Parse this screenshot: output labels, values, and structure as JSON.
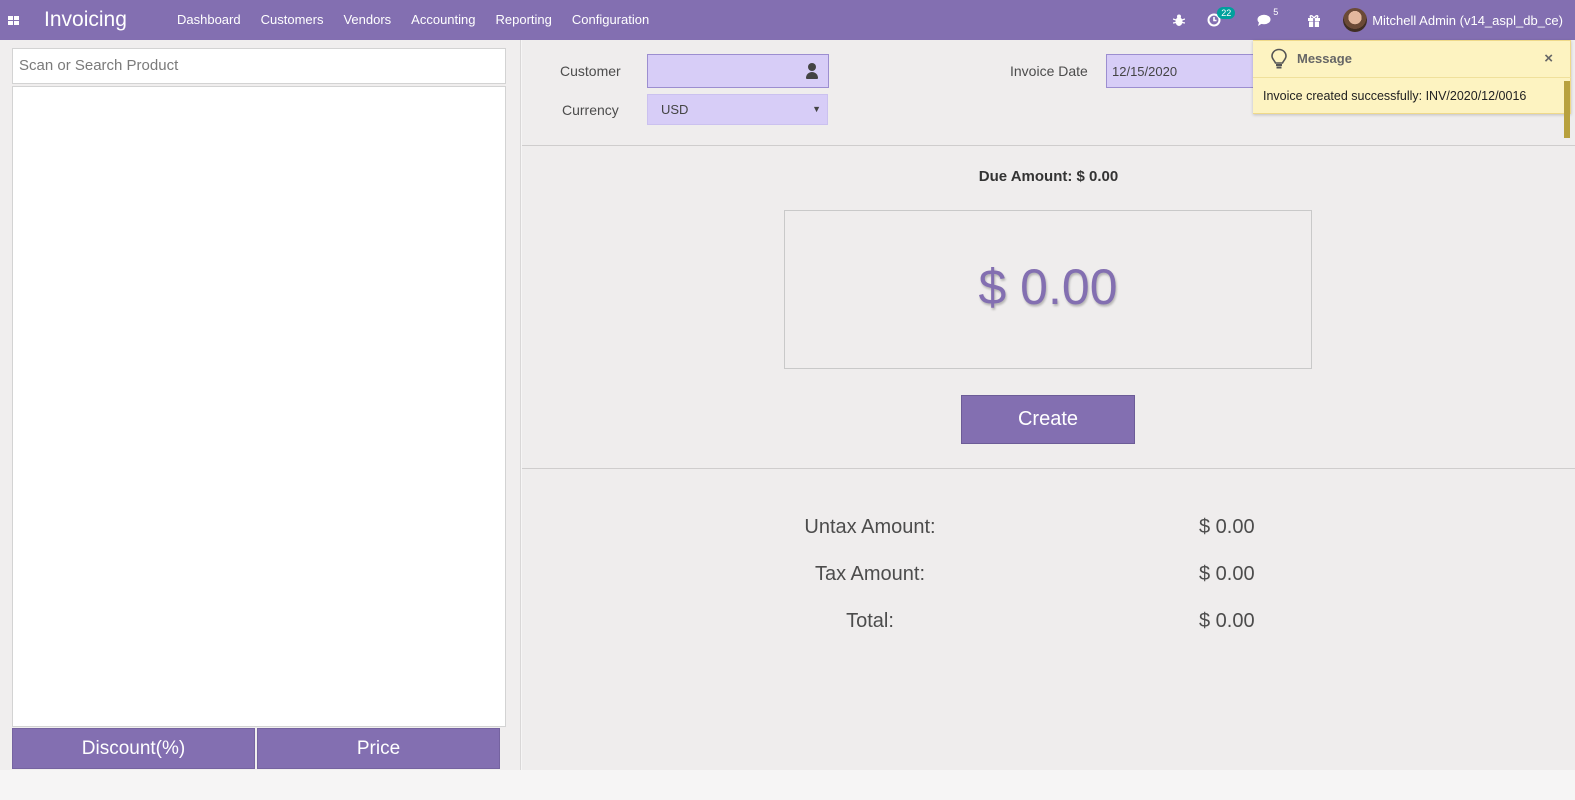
{
  "navbar": {
    "app_title": "Invoicing",
    "menu": [
      "Dashboard",
      "Customers",
      "Vendors",
      "Accounting",
      "Reporting",
      "Configuration"
    ],
    "activity_count": "22",
    "messages_count": "5",
    "user_name": "Mitchell Admin (v14_aspl_db_ce)",
    "icons": [
      "apps-grid-icon",
      "bug-icon",
      "activity-clock-icon",
      "chat-icon",
      "gift-icon"
    ],
    "color": "#836fb1"
  },
  "left_panel": {
    "search_placeholder": "Scan or Search Product",
    "discount_label": "Discount(%)",
    "price_label": "Price"
  },
  "form": {
    "customer_label": "Customer",
    "customer_value": "",
    "currency_label": "Currency",
    "currency_value": "USD",
    "invoice_date_label": "Invoice Date",
    "invoice_date_value": "12/15/2020"
  },
  "summary": {
    "due_amount": "Due Amount: $ 0.00",
    "big_amount": "$ 0.00",
    "create_label": "Create",
    "untax_label": "Untax Amount:",
    "untax_value": "$ 0.00",
    "tax_label": "Tax Amount:",
    "tax_value": "$ 0.00",
    "total_label": "Total:",
    "total_value": "$ 0.00"
  },
  "toast": {
    "title": "Message",
    "close": "×",
    "text": "Invoice created successfully: INV/2020/12/0016",
    "color": "#fdf3c1"
  }
}
